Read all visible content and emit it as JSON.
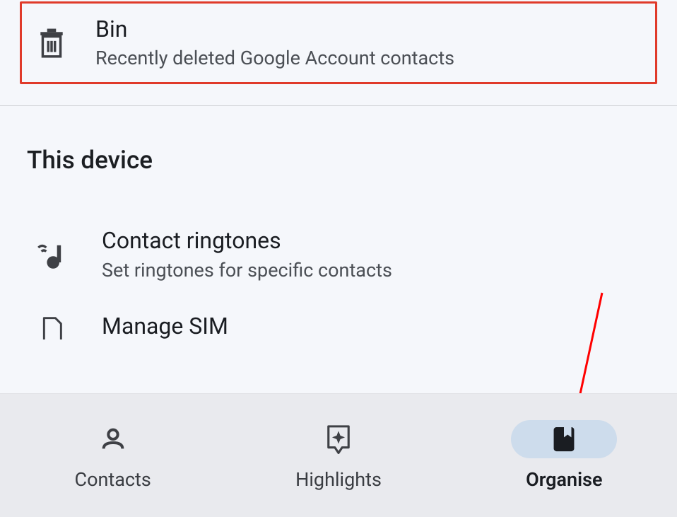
{
  "bin": {
    "title": "Bin",
    "subtitle": "Recently deleted Google Account contacts"
  },
  "device_section": {
    "header": "This device",
    "items": [
      {
        "title": "Contact ringtones",
        "subtitle": "Set ringtones for specific contacts"
      },
      {
        "title": "Manage SIM",
        "subtitle": ""
      }
    ]
  },
  "nav": {
    "items": [
      {
        "label": "Contacts",
        "icon": "person",
        "active": false
      },
      {
        "label": "Highlights",
        "icon": "sparkle-badge",
        "active": false
      },
      {
        "label": "Organise",
        "icon": "bookmark-book",
        "active": true
      }
    ]
  },
  "annotations": {
    "highlight_color": "#e03a2a",
    "arrow_color": "#ff0000"
  }
}
